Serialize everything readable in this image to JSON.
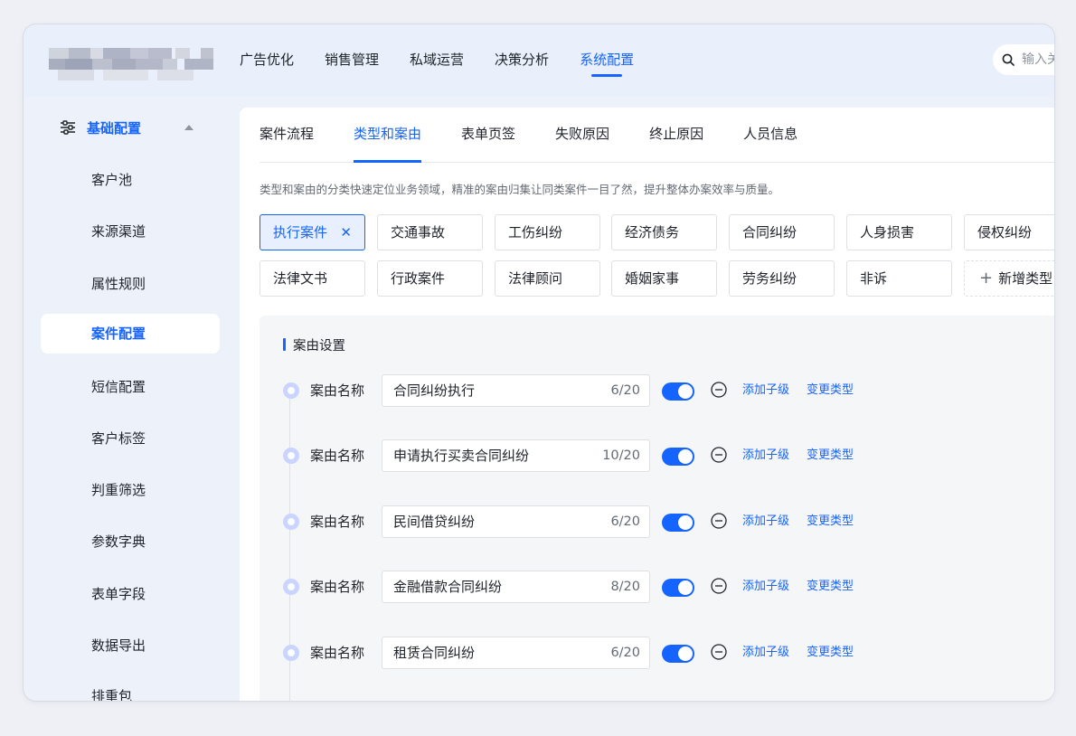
{
  "nav": {
    "items": [
      "广告优化",
      "销售管理",
      "私域运营",
      "决策分析",
      "系统配置"
    ],
    "active_index": 4
  },
  "search": {
    "placeholder": "输入关键词"
  },
  "sidebar": {
    "group_label": "基础配置",
    "items": [
      "客户池",
      "来源渠道",
      "属性规则",
      "案件配置",
      "短信配置",
      "客户标签",
      "判重筛选",
      "参数字典",
      "表单字段",
      "数据导出",
      "排重包"
    ],
    "active_index": 3
  },
  "tabs": {
    "items": [
      "案件流程",
      "类型和案由",
      "表单页签",
      "失败原因",
      "终止原因",
      "人员信息"
    ],
    "active_index": 1
  },
  "description": "类型和案由的分类快速定位业务领域，精准的案由归集让同类案件一目了然，提升整体办案效率与质量。",
  "types": {
    "items": [
      "执行案件",
      "交通事故",
      "工伤纠纷",
      "经济债务",
      "合同纠纷",
      "人身损害",
      "侵权纠纷",
      "法律文书",
      "行政案件",
      "法律顾问",
      "婚姻家事",
      "劳务纠纷",
      "非诉"
    ],
    "active_index": 0,
    "add_label": "新增类型"
  },
  "panel": {
    "title": "案由设置",
    "field_label": "案由名称",
    "add_child_label": "添加子级",
    "change_type_label": "变更类型",
    "rows": [
      {
        "value": "合同纠纷执行",
        "count": "6/20",
        "enabled": true
      },
      {
        "value": "申请执行买卖合同纠纷",
        "count": "10/20",
        "enabled": true
      },
      {
        "value": "民间借贷纠纷",
        "count": "6/20",
        "enabled": true
      },
      {
        "value": "金融借款合同纠纷",
        "count": "8/20",
        "enabled": true
      },
      {
        "value": "租赁合同纠纷",
        "count": "6/20",
        "enabled": true
      }
    ]
  },
  "colors": {
    "accent": "#1664ff",
    "dot": "#c9d5ff",
    "frame_bg": "#edf2fa"
  }
}
